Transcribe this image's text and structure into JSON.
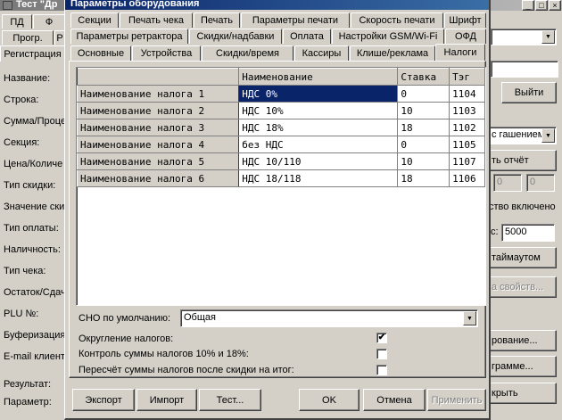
{
  "background_window": {
    "title": "Тест \"Др",
    "tabs_row1": [
      "ПД",
      "Ф"
    ],
    "tabs_row2": [
      "Прогр.",
      "Р"
    ],
    "tabs_row3": [
      "Регистрация"
    ],
    "labels": [
      "Название:",
      "Строка:",
      "Сумма/Проце",
      "Секция:",
      "Цена/Количе",
      "Тип скидки:",
      "Значение ски",
      "Тип оплаты:",
      "Наличность:",
      "Тип чека:",
      "Остаток/Сдач",
      "PLU №:",
      "Буферизация:",
      "E-mail клиента"
    ],
    "result_label": "Результат:",
    "param_label": "Параметр:",
    "exit_button": "Выйти",
    "combo_value": "с гашением",
    "report_button": "ть отчёт",
    "small_input_1": "0",
    "small_input_2": "0",
    "mode_text": "ство включено",
    "timeout_label": "с:",
    "timeout_value": "5000",
    "timeout_button": "таймаутом",
    "props_button": "а свойств...",
    "prog_button_1": "рование...",
    "prog_button_2": "грамме...",
    "hide_button": "крыть"
  },
  "dialog": {
    "title": "Параметры оборудования",
    "tabs_row1": [
      "Секции",
      "Печать чека",
      "Печать",
      "Параметры печати",
      "Скорость печати",
      "Шрифт"
    ],
    "tabs_row2": [
      "Параметры ретрактора",
      "Скидки/надбавки",
      "Оплата",
      "Настройки GSM/Wi-Fi",
      "ОФД"
    ],
    "tabs_row3": [
      "Основные",
      "Устройства",
      "Скидки/время",
      "Кассиры",
      "Клише/реклама",
      "Налоги"
    ],
    "active_tab": "Налоги",
    "grid": {
      "headers": [
        "",
        "Наименование",
        "Ставка",
        "Тэг"
      ],
      "rows": [
        [
          "Наименование налога 1",
          "НДС 0%",
          "0",
          "1104"
        ],
        [
          "Наименование налога 2",
          "НДС 10%",
          "10",
          "1103"
        ],
        [
          "Наименование налога 3",
          "НДС 18%",
          "18",
          "1102"
        ],
        [
          "Наименование налога 4",
          "без НДС",
          "0",
          "1105"
        ],
        [
          "Наименование налога 5",
          "НДС 10/110",
          "10",
          "1107"
        ],
        [
          "Наименование налога 6",
          "НДС 18/118",
          "18",
          "1106"
        ]
      ]
    },
    "sno_label": "СНО по умолчанию:",
    "sno_value": "Общая",
    "checkboxes": [
      {
        "label": "Округление налогов:",
        "checked": "✔"
      },
      {
        "label": "Контроль суммы налогов 10% и 18%:",
        "checked": ""
      },
      {
        "label": "Пересчёт суммы налогов после скидки на итог:",
        "checked": ""
      }
    ],
    "buttons": {
      "export": "Экспорт",
      "import": "Импорт",
      "test": "Тест...",
      "ok": "OK",
      "cancel": "Отмена",
      "apply": "Применить"
    }
  }
}
